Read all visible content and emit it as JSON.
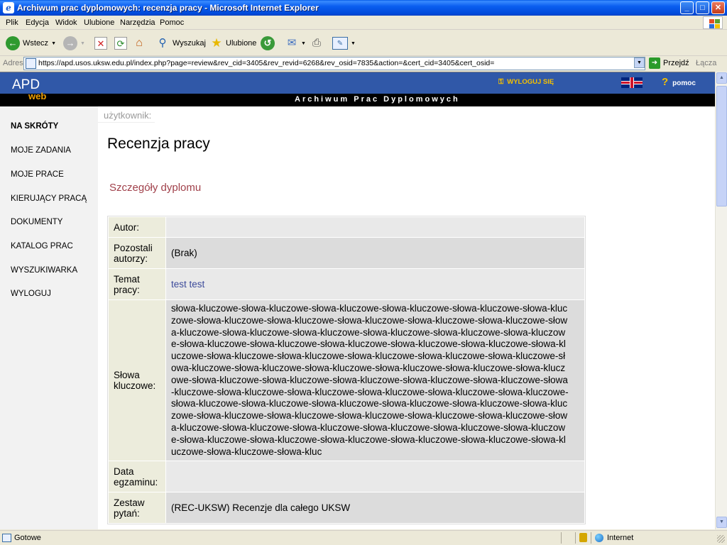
{
  "window": {
    "title": "Archiwum prac dyplomowych: recenzja pracy - Microsoft Internet Explorer",
    "app_icon": "ie-icon",
    "min": "_",
    "max": "□",
    "close": "✕"
  },
  "menu": [
    "Plik",
    "Edycja",
    "Widok",
    "Ulubione",
    "Narzędzia",
    "Pomoc"
  ],
  "toolbar": {
    "back": "Wstecz",
    "search": "Wyszukaj",
    "favorites": "Ulubione"
  },
  "address": {
    "label": "Adres",
    "url": "https://apd.usos.uksw.edu.pl/index.php?page=review&rev_cid=3405&rev_revid=6268&rev_osid=7835&action=&cert_cid=3405&cert_osid=",
    "go": "Przejdź",
    "links": "Łącza"
  },
  "apd": {
    "logo": "APD",
    "logo_sub": "web",
    "logout": "WYLOGUJ SIĘ",
    "help": "pomoc",
    "subtitle": "Archiwum Prac Dyplomowych"
  },
  "nav": [
    {
      "label": "NA SKRÓTY",
      "active": true
    },
    {
      "label": "MOJE ZADANIA"
    },
    {
      "label": "MOJE PRACE"
    },
    {
      "label": "KIERUJĄCY PRACĄ"
    },
    {
      "label": "DOKUMENTY"
    },
    {
      "label": "KATALOG PRAC"
    },
    {
      "label": "WYSZUKIWARKA"
    },
    {
      "label": "WYLOGUJ"
    }
  ],
  "main": {
    "user_label": "użytkownik:",
    "page_title": "Recenzja pracy",
    "section_title": "Szczegóły dyplomu",
    "rows": [
      {
        "label": "Autor:",
        "value": ""
      },
      {
        "label": "Pozostali autorzy:",
        "value": "(Brak)"
      },
      {
        "label": "Temat pracy:",
        "value": "test test"
      },
      {
        "label": "Słowa kluczowe:",
        "value": "słowa-kluczowe-słowa-kluczowe-słowa-kluczowe-słowa-kluczowe-słowa-kluczowe-słowa-kluczowe-słowa-kluczowe-słowa-kluczowe-słowa-kluczowe-słowa-kluczowe-słowa-kluczowe-słowa-kluczowe-słowa-kluczowe-słowa-kluczowe-słowa-kluczowe-słowa-kluczowe-słowa-kluczowe-słowa-kluczowe-słowa-kluczowe-słowa-kluczowe-słowa-kluczowe-słowa-kluczowe-słowa-kluczowe-słowa-kluczowe-słowa-kluczowe-słowa-kluczowe-słowa-kluczowe-słowa-kluczowe-słowa-kluczowe-słowa-kluczowe-słowa-kluczowe-słowa-kluczowe-słowa-kluczowe-słowa-kluczowe-słowa-kluczowe-słowa-kluczowe-słowa-kluczowe-słowa-kluczowe-słowa-kluczowe-słowa-kluczowe-słowa-kluczowe-słowa-kluczowe-słowa-kluczowe-słowa-kluczowe-słowa-kluczowe-słowa-kluczowe-słowa-kluczowe-słowa-kluczowe-słowa-kluczowe-słowa-kluczowe-słowa-kluczowe-słowa-kluczowe-słowa-kluczowe-słowa-kluczowe-słowa-kluczowe-słowa-kluczowe-słowa-kluczowe-słowa-kluczowe-słowa-kluczowe-słowa-kluczowe-słowa-kluczowe-słowa-kluczowe-słowa-kluczowe-słowa-kluczowe-słowa-kluczowe-słowa-kluczowe-słowa-kluczowe-słowa-kluczowe-słowa-kluczowe-słowa-kluc"
      },
      {
        "label": "Data egzaminu:",
        "value": ""
      },
      {
        "label": "Zestaw pytań:",
        "value": "(REC-UKSW) Recenzje dla całego UKSW"
      }
    ]
  },
  "status": {
    "text": "Gotowe",
    "zone": "Internet"
  },
  "colors": {
    "apd_blue": "#3058a8",
    "apd_orange": "#f0a000",
    "section_red": "#a0404a",
    "link_blue": "#3c4a9a"
  }
}
